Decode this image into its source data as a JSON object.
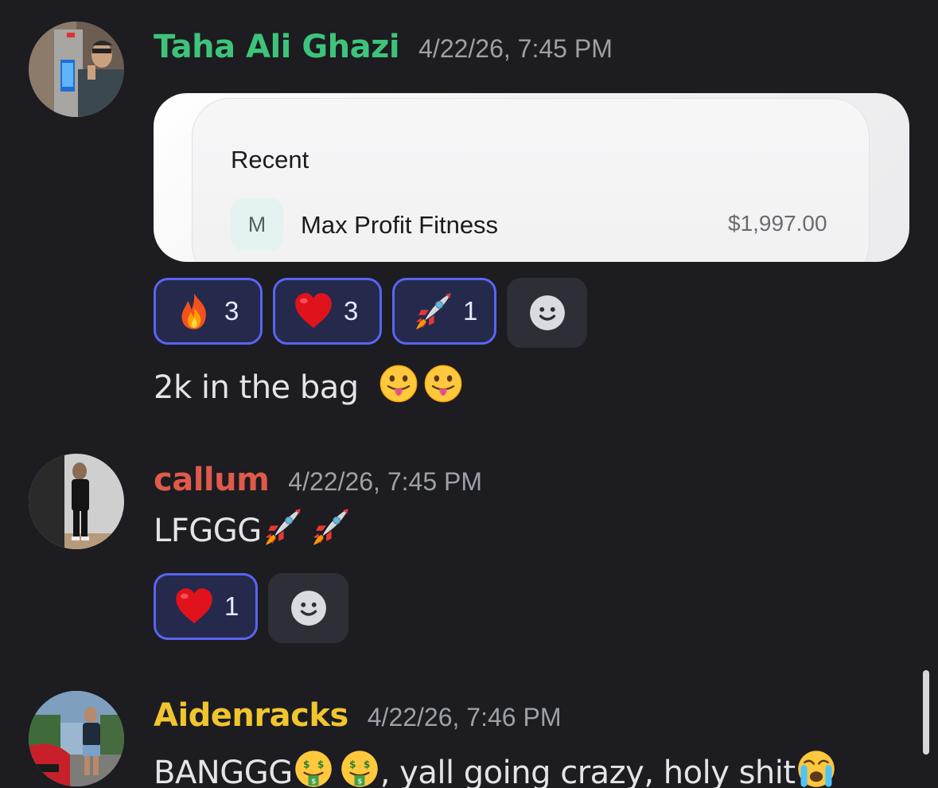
{
  "messages": [
    {
      "username": "Taha Ali Ghazi",
      "username_color": "#3ec47a",
      "timestamp": "4/22/26, 7:45 PM",
      "embed": {
        "heading": "Recent",
        "merchant_initial": "M",
        "merchant_name": "Max Profit Fitness",
        "amount": "$1,997.00"
      },
      "reactions": [
        {
          "icon": "fire-emoji",
          "count": "3"
        },
        {
          "icon": "red-heart-emoji",
          "count": "3"
        },
        {
          "icon": "rocket-emoji",
          "count": "1"
        }
      ],
      "text": "2k in the bag",
      "text_emojis": [
        "face-with-tongue-emoji",
        "face-with-tongue-emoji"
      ]
    },
    {
      "username": "callum",
      "username_color": "#e0594a",
      "timestamp": "4/22/26, 7:45 PM",
      "text": "LFGGG",
      "text_emojis": [
        "rocket-emoji",
        "rocket-emoji"
      ],
      "reactions": [
        {
          "icon": "red-heart-emoji",
          "count": "1"
        }
      ]
    },
    {
      "username": "Aidenracks",
      "username_color": "#f0c52e",
      "timestamp": "4/22/26, 7:46 PM",
      "text_part1": "BANGGG",
      "text_part2": ", yall going crazy, holy shit",
      "text_emojis": [
        "money-mouth-face-emoji",
        "money-mouth-face-emoji",
        "loudly-crying-face-emoji"
      ]
    }
  ],
  "add_reaction_icon": "smiley-add-reaction-icon",
  "reaction_accent": "#5865f2"
}
